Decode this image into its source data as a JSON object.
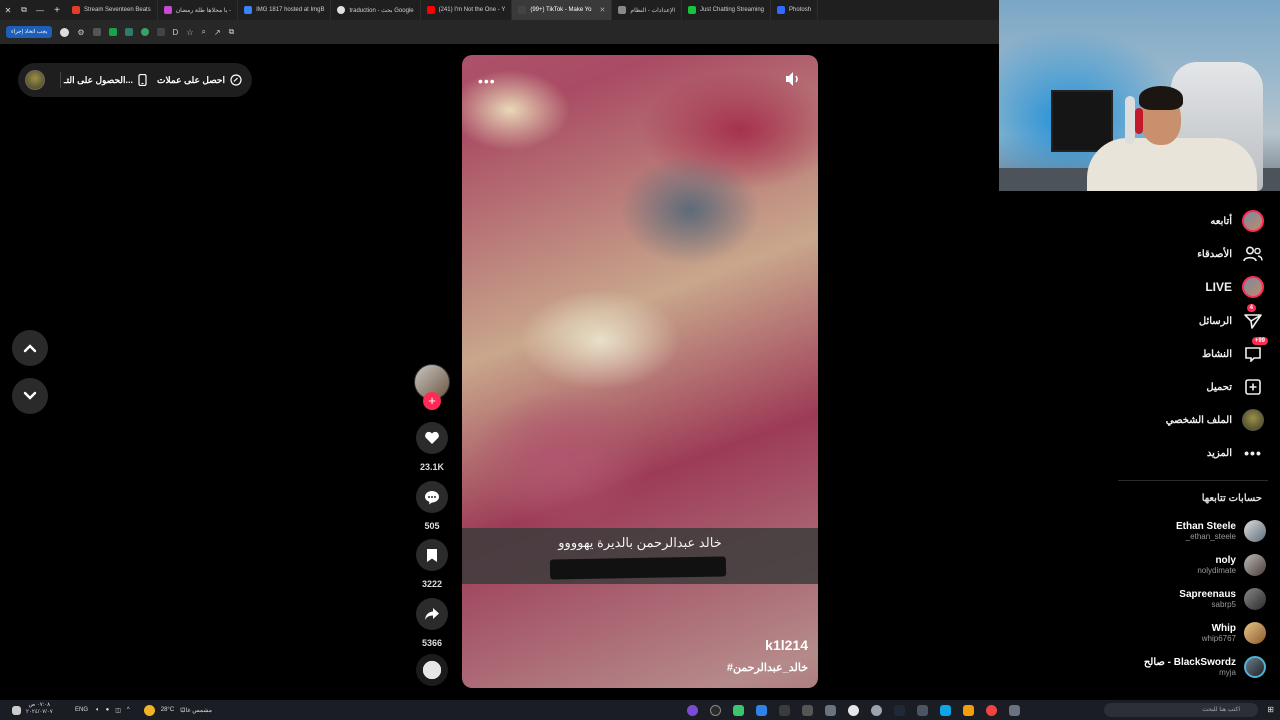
{
  "browser": {
    "tabs": [
      {
        "label": "Stream Seventeen Beats",
        "color": "#e23d28",
        "active": false
      },
      {
        "label": "يا محلاها طلة رمضان -",
        "color": "#c54bd1",
        "active": false
      },
      {
        "label": "IMG 1817 hosted at ImgB",
        "color": "#3b82f6",
        "active": false
      },
      {
        "label": "traduction - بحث Google",
        "color": "#e0e0e0",
        "active": false
      },
      {
        "label": "(241) I'm Not the One - Y",
        "color": "#ff0000",
        "active": false
      },
      {
        "label": "(99+) TikTok - Make Yo",
        "color": "#111111",
        "active": true
      },
      {
        "label": "الإعدادات - النظام",
        "color": "#888888",
        "active": false
      },
      {
        "label": "Just Chatting Streaming",
        "color": "#18c43a",
        "active": false
      },
      {
        "label": "Photosh",
        "color": "#2f6bff",
        "active": false
      }
    ],
    "toolbar_button": "يجب اتخاذ إجراء"
  },
  "topbar": {
    "get_coins": "احصل على عملات",
    "get_app": "الحصول على التـ..."
  },
  "video": {
    "caption": "خالد عبدالرحمن بالديرة يهوووو",
    "username": "k1l214",
    "hashtag": "#خالد_عبدالرحمن"
  },
  "actions": {
    "likes": "23.1K",
    "comments": "505",
    "saves": "3222",
    "shares": "5366"
  },
  "sidebar": {
    "following": "أتابعه",
    "friends": "الأصدقاء",
    "live": "LIVE",
    "messages": "الرسائل",
    "messages_badge": "4",
    "activity": "النشاط",
    "activity_badge": "99+",
    "upload": "تحميل",
    "profile": "الملف الشخصي",
    "more": "المزيد",
    "following_accounts_heading": "حسابات تتابعها",
    "accounts": [
      {
        "name": "Ethan Steele",
        "handle": "_ethan_steele"
      },
      {
        "name": "noly",
        "handle": "nolydimate"
      },
      {
        "name": "Sapreenaus",
        "handle": "sabrp5"
      },
      {
        "name": "Whip",
        "handle": "whip6767"
      },
      {
        "name": "صالح - BlackSwordz",
        "handle": "myja"
      }
    ]
  },
  "taskbar": {
    "weather": "28°C",
    "weather_label": "مشمس غالبًا",
    "lang": "ENG",
    "search_placeholder": "اكتب هنا للبحث",
    "time": "٠٧:٠٨ ص",
    "date": "٢٠٢٤/٠٧/٠٧"
  },
  "colors": {
    "accent": "#fe2c55",
    "background": "#000000"
  }
}
